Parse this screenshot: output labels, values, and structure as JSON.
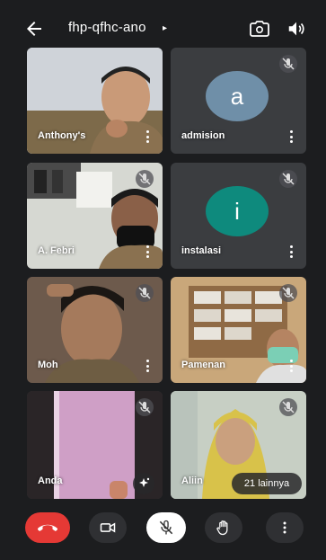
{
  "header": {
    "meeting_code": "fhp-qfhc-ano",
    "caret": "▸",
    "icons": [
      "back-arrow-icon",
      "switch-camera-icon",
      "speaker-icon"
    ]
  },
  "participants": [
    {
      "name": "Anthony's",
      "muted": false,
      "type": "video"
    },
    {
      "name": "admision",
      "muted": true,
      "type": "avatar",
      "initial": "a",
      "color": "#6f8fa8"
    },
    {
      "name": "A. Febri",
      "muted": true,
      "type": "video"
    },
    {
      "name": "instalasi",
      "muted": true,
      "type": "avatar",
      "initial": "i",
      "color": "#0e8a7d"
    },
    {
      "name": "Moh",
      "muted": true,
      "type": "video"
    },
    {
      "name": "Pamenan",
      "muted": true,
      "type": "video"
    },
    {
      "name": "Anda",
      "muted": true,
      "type": "video"
    },
    {
      "name": "Aliin",
      "muted": true,
      "type": "video"
    }
  ],
  "more_participants_label": "21 lainnya",
  "controls": {
    "end_call_color": "#e53935",
    "buttons": [
      "end-call-icon",
      "camera-icon",
      "mic-off-icon",
      "raise-hand-icon",
      "more-options-icon"
    ]
  }
}
